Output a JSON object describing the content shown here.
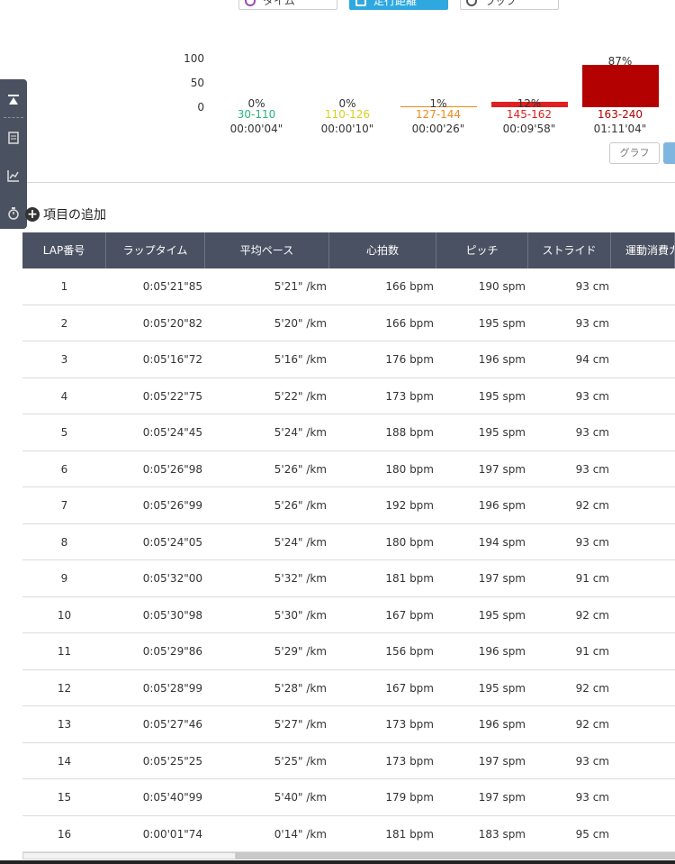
{
  "top_tabs": [
    {
      "label": "タイム",
      "icon": "clock-icon"
    },
    {
      "label": "走行距離",
      "icon": "distance-icon",
      "active": true
    },
    {
      "label": "ラップ",
      "icon": "stopwatch-icon"
    }
  ],
  "chart_data": {
    "type": "bar",
    "title": "",
    "categories": [
      "30-110",
      "110-126",
      "127-144",
      "145-162",
      "163-240"
    ],
    "values": [
      0,
      0,
      1,
      12,
      87
    ],
    "value_labels": [
      "0%",
      "0%",
      "1%",
      "12%",
      "87%"
    ],
    "durations": [
      "00:00'04\"",
      "00:00'10\"",
      "00:00'26\"",
      "00:09'58\"",
      "01:11'04\""
    ],
    "colors": [
      "#2bb27a",
      "#d8d020",
      "#f08a1c",
      "#e02020",
      "#b30000"
    ],
    "yticks": [
      "100",
      "50",
      "0"
    ],
    "ylim": [
      0,
      100
    ]
  },
  "graph_button": "グラフ",
  "sidebar_icons": [
    "collapse-top-icon",
    "document-icon",
    "chart-line-icon",
    "stopwatch-icon"
  ],
  "add_item": "項目の追加",
  "table": {
    "headers": [
      "LAP番号",
      "ラップタイム",
      "平均ペース",
      "心拍数",
      "ピッチ",
      "ストライド",
      "運動消費カ"
    ],
    "rows": [
      [
        "1",
        "0:05'21\"85",
        "5'21\" /km",
        "166 bpm",
        "190 spm",
        "93 cm"
      ],
      [
        "2",
        "0:05'20\"82",
        "5'20\" /km",
        "166 bpm",
        "195 spm",
        "93 cm"
      ],
      [
        "3",
        "0:05'16\"72",
        "5'16\" /km",
        "176 bpm",
        "196 spm",
        "94 cm"
      ],
      [
        "4",
        "0:05'22\"75",
        "5'22\" /km",
        "173 bpm",
        "195 spm",
        "93 cm"
      ],
      [
        "5",
        "0:05'24\"45",
        "5'24\" /km",
        "188 bpm",
        "195 spm",
        "93 cm"
      ],
      [
        "6",
        "0:05'26\"98",
        "5'26\" /km",
        "180 bpm",
        "197 spm",
        "93 cm"
      ],
      [
        "7",
        "0:05'26\"99",
        "5'26\" /km",
        "192 bpm",
        "196 spm",
        "92 cm"
      ],
      [
        "8",
        "0:05'24\"05",
        "5'24\" /km",
        "180 bpm",
        "194 spm",
        "93 cm"
      ],
      [
        "9",
        "0:05'32\"00",
        "5'32\" /km",
        "181 bpm",
        "197 spm",
        "91 cm"
      ],
      [
        "10",
        "0:05'30\"98",
        "5'30\" /km",
        "167 bpm",
        "195 spm",
        "92 cm"
      ],
      [
        "11",
        "0:05'29\"86",
        "5'29\" /km",
        "156 bpm",
        "196 spm",
        "91 cm"
      ],
      [
        "12",
        "0:05'28\"99",
        "5'28\" /km",
        "167 bpm",
        "195 spm",
        "92 cm"
      ],
      [
        "13",
        "0:05'27\"46",
        "5'27\" /km",
        "173 bpm",
        "196 spm",
        "92 cm"
      ],
      [
        "14",
        "0:05'25\"25",
        "5'25\" /km",
        "173 bpm",
        "197 spm",
        "93 cm"
      ],
      [
        "15",
        "0:05'40\"99",
        "5'40\" /km",
        "179 bpm",
        "197 spm",
        "93 cm"
      ],
      [
        "16",
        "0:00'01\"74",
        "0'14\" /km",
        "181 bpm",
        "183 spm",
        "95 cm"
      ]
    ]
  }
}
